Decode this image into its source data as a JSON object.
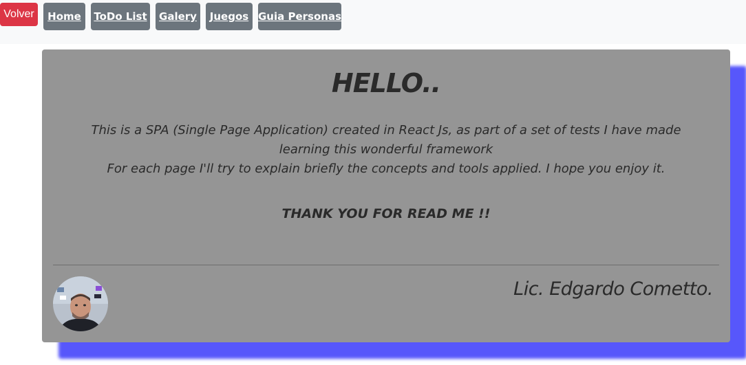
{
  "nav": {
    "back_label": "Volver",
    "items": [
      {
        "label": "Home"
      },
      {
        "label": "ToDo List"
      },
      {
        "label": "Galery"
      },
      {
        "label": "Juegos"
      },
      {
        "label": "Guia Personas"
      }
    ]
  },
  "card": {
    "title": "HELLO..",
    "description_line1": "This is a SPA (Single Page Application) created in React Js, as part of a set of tests I have made learning this wonderful framework",
    "description_line2": "For each page I'll try to explain briefly the concepts and tools applied. I hope you enjoy it.",
    "thanks": "THANK YOU FOR READ ME !!",
    "signature": "Lic. Edgardo Cometto."
  },
  "colors": {
    "back_button": "#dc3545",
    "nav_button": "#6c757d",
    "card_background": "#959595",
    "card_shadow": "#5757fb"
  }
}
